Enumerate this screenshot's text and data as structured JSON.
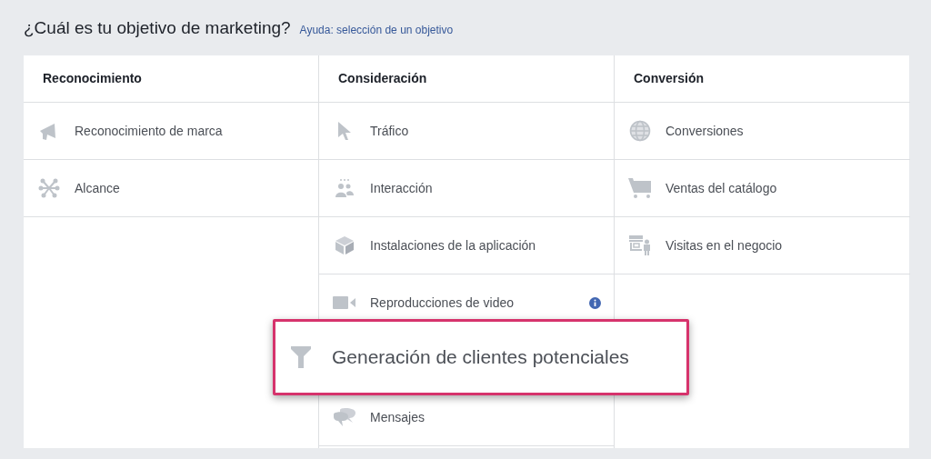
{
  "heading": {
    "title": "¿Cuál es tu objetivo de marketing?",
    "help_link": "Ayuda: selección de un objetivo"
  },
  "columns": [
    {
      "title": "Reconocimiento",
      "items": [
        {
          "label": "Reconocimiento de marca"
        },
        {
          "label": "Alcance"
        }
      ]
    },
    {
      "title": "Consideración",
      "items": [
        {
          "label": "Tráfico"
        },
        {
          "label": "Interacción"
        },
        {
          "label": "Instalaciones de la aplicación"
        },
        {
          "label": "Reproducciones de video",
          "info": true
        },
        {
          "label": "Generación de clientes potenciales",
          "highlighted": true
        },
        {
          "label": "Mensajes"
        }
      ]
    },
    {
      "title": "Conversión",
      "items": [
        {
          "label": "Conversiones"
        },
        {
          "label": "Ventas del catálogo"
        },
        {
          "label": "Visitas en el negocio"
        }
      ]
    }
  ]
}
